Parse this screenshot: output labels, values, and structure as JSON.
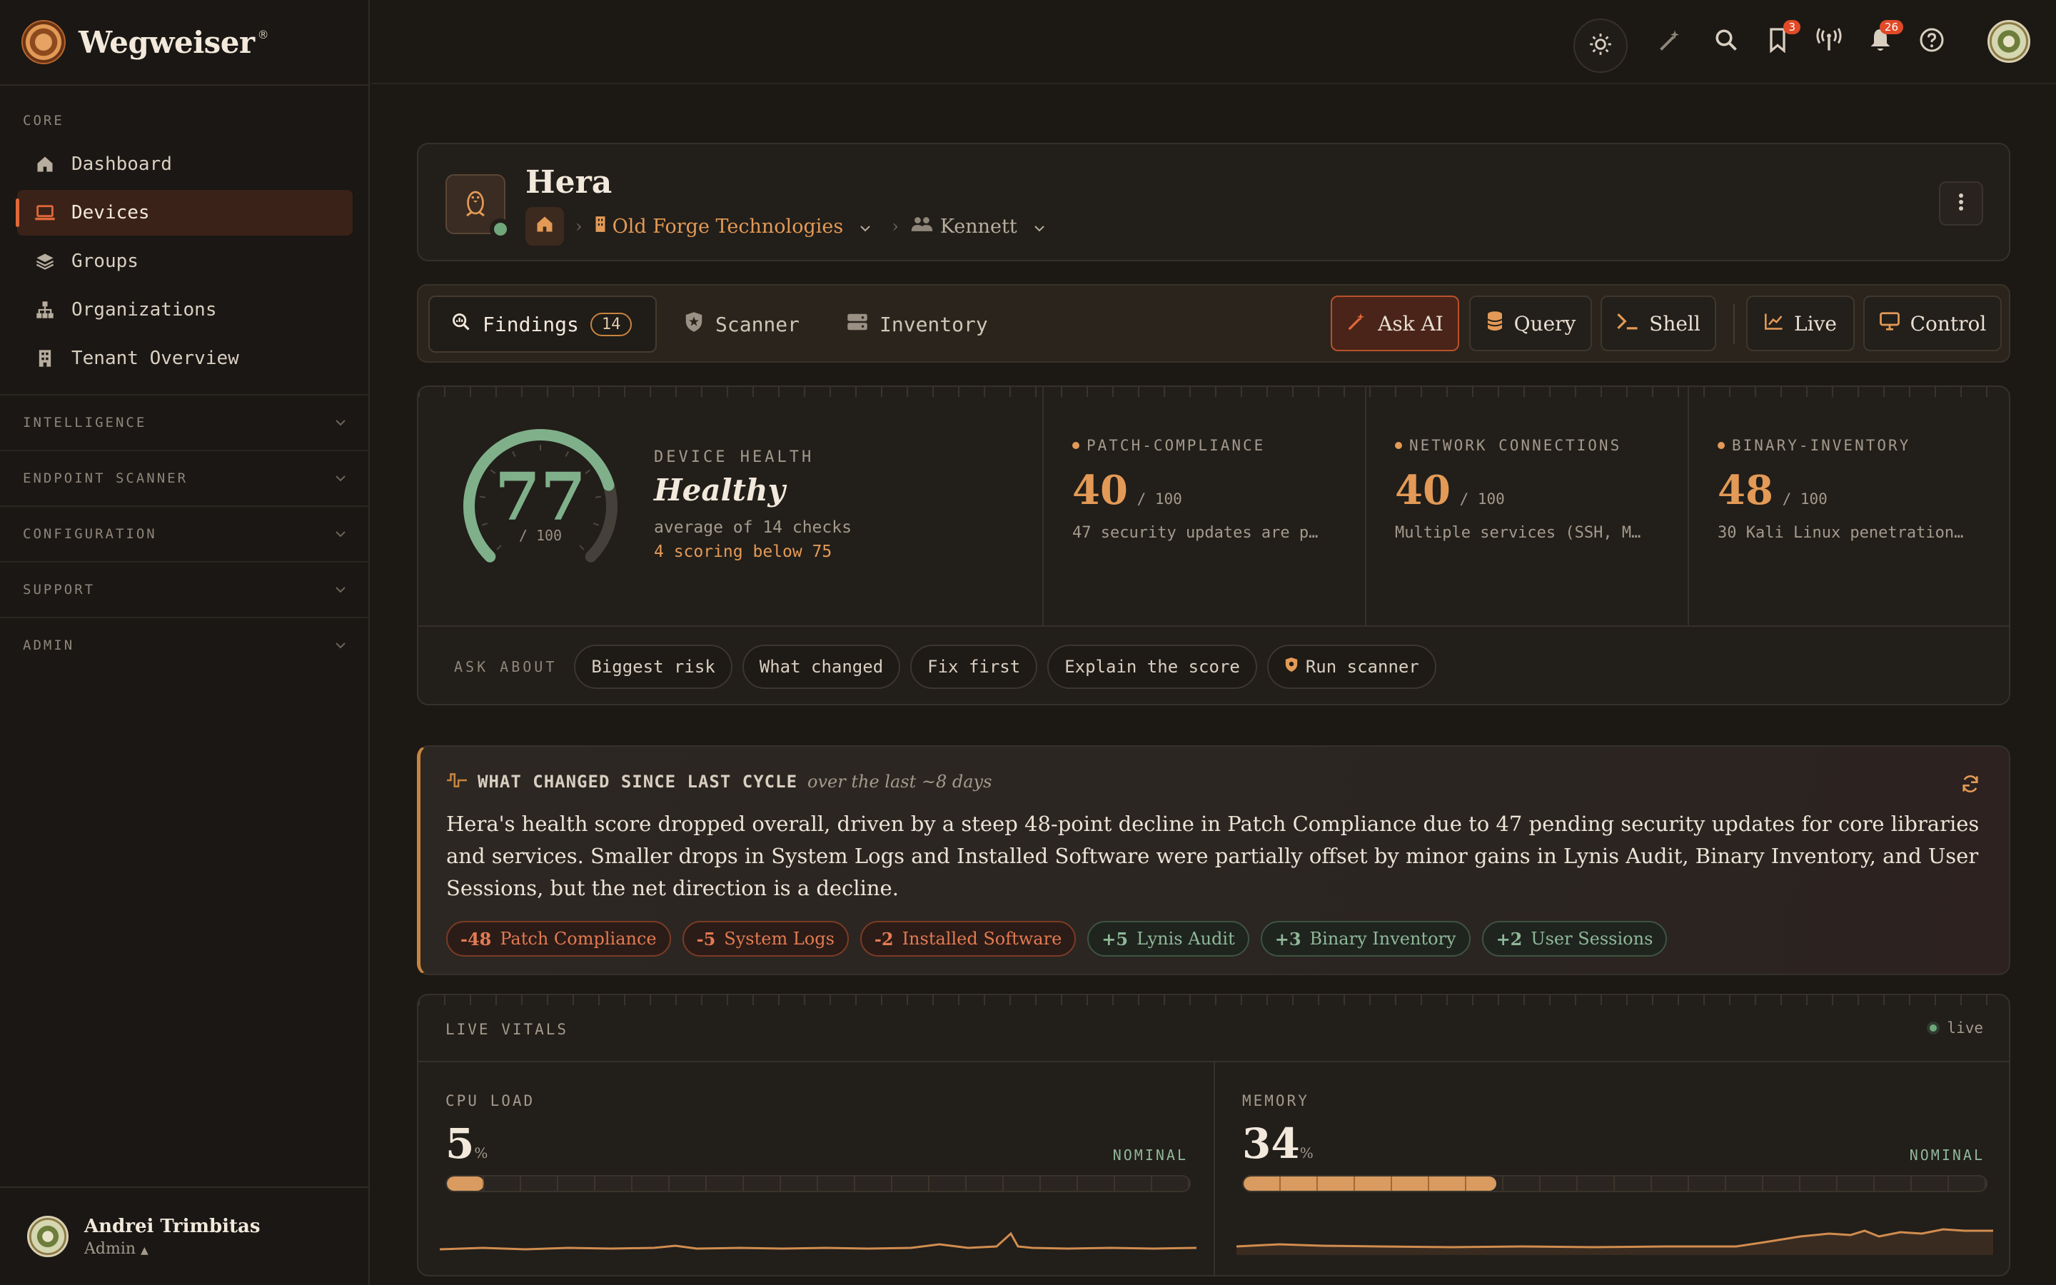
{
  "brand": {
    "name": "Wegweiser",
    "reg": "®"
  },
  "sidebar": {
    "core_label": "CORE",
    "items": [
      {
        "label": "Dashboard",
        "icon": "home-icon"
      },
      {
        "label": "Devices",
        "icon": "laptop-icon",
        "active": true
      },
      {
        "label": "Groups",
        "icon": "layers-icon"
      },
      {
        "label": "Organizations",
        "icon": "org-chart-icon"
      },
      {
        "label": "Tenant Overview",
        "icon": "building-icon"
      }
    ],
    "sections": [
      "INTELLIGENCE",
      "ENDPOINT SCANNER",
      "CONFIGURATION",
      "SUPPORT",
      "ADMIN"
    ],
    "user": {
      "name": "Andrei Trimbitas",
      "role": "Admin"
    }
  },
  "topbar": {
    "bookmarks_badge": "3",
    "notifications_badge": "26"
  },
  "device": {
    "name": "Hera",
    "org": "Old Forge Technologies",
    "site": "Kennett"
  },
  "tabs": {
    "findings": "Findings",
    "findings_count": "14",
    "scanner": "Scanner",
    "inventory": "Inventory",
    "ask_ai": "Ask AI",
    "query": "Query",
    "shell": "Shell",
    "live": "Live",
    "control": "Control"
  },
  "health": {
    "score": "77",
    "score_value": 77,
    "out_of": "/ 100",
    "label": "DEVICE HEALTH",
    "status": "Healthy",
    "average": "average of 14 checks",
    "below": "4 scoring below 75",
    "metrics": [
      {
        "label": "PATCH-COMPLIANCE",
        "value": "40",
        "out_of": "/ 100",
        "desc": "47 security updates are p…"
      },
      {
        "label": "NETWORK CONNECTIONS",
        "value": "40",
        "out_of": "/ 100",
        "desc": "Multiple services (SSH, M…"
      },
      {
        "label": "BINARY-INVENTORY",
        "value": "48",
        "out_of": "/ 100",
        "desc": "30 Kali Linux penetration…"
      }
    ],
    "ask_label": "ASK ABOUT",
    "ask_chips": [
      "Biggest risk",
      "What changed",
      "Fix first",
      "Explain the score",
      "Run scanner"
    ]
  },
  "changes": {
    "title": "WHAT CHANGED SINCE LAST CYCLE",
    "period": "over the last ~8 days",
    "summary": "Hera's health score dropped overall, driven by a steep 48-point decline in Patch Compliance due to 47 pending security updates for core libraries and services. Smaller drops in System Logs and Installed Software were partially offset by minor gains in Lynis Audit, Binary Inventory, and User Sessions, but the net direction is a decline.",
    "deltas": [
      {
        "delta": "-48",
        "label": "Patch Compliance",
        "dir": "neg"
      },
      {
        "delta": "-5",
        "label": "System Logs",
        "dir": "neg"
      },
      {
        "delta": "-2",
        "label": "Installed Software",
        "dir": "neg"
      },
      {
        "delta": "+5",
        "label": "Lynis Audit",
        "dir": "pos"
      },
      {
        "delta": "+3",
        "label": "Binary Inventory",
        "dir": "pos"
      },
      {
        "delta": "+2",
        "label": "User Sessions",
        "dir": "pos"
      }
    ]
  },
  "vitals": {
    "label": "LIVE VITALS",
    "live": "live",
    "cpu": {
      "label": "CPU LOAD",
      "value": "5",
      "unit": "%",
      "percent": 5,
      "status": "NOMINAL"
    },
    "memory": {
      "label": "MEMORY",
      "value": "34",
      "unit": "%",
      "percent": 34,
      "status": "NOMINAL"
    }
  },
  "colors": {
    "accent": "#e39a56",
    "healthy": "#7fb08a",
    "danger": "#e47a52"
  }
}
